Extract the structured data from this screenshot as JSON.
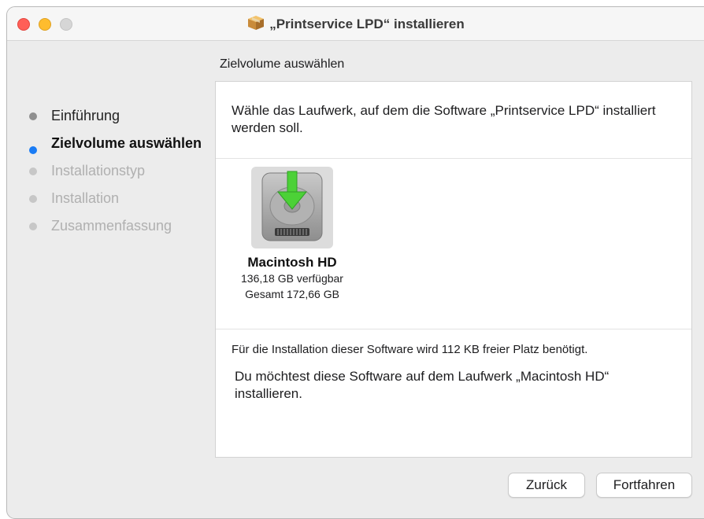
{
  "window": {
    "title": "„Printservice LPD“ installieren",
    "icon": "package-icon"
  },
  "section_heading": "Zielvolume auswählen",
  "steps": [
    {
      "label": "Einführung",
      "state": "done"
    },
    {
      "label": "Zielvolume auswählen",
      "state": "active"
    },
    {
      "label": "Installationstyp",
      "state": "pending"
    },
    {
      "label": "Installation",
      "state": "pending"
    },
    {
      "label": "Zusammenfassung",
      "state": "pending"
    }
  ],
  "panel": {
    "intro": "Wähle das Laufwerk, auf dem die Software „Printservice LPD“ installiert werden soll.",
    "volume": {
      "name": "Macintosh HD",
      "available": "136,18 GB verfügbar",
      "total": "Gesamt 172,66 GB",
      "icon": "hard-drive-install-icon"
    },
    "space_needed": "Für die Installation dieser Software wird 112 KB freier Platz benötigt.",
    "confirm": "Du möchtest diese Software auf dem Laufwerk „Macintosh HD“ installieren."
  },
  "buttons": {
    "back": "Zurück",
    "continue": "Fortfahren"
  },
  "colors": {
    "accent": "#1a7cf5",
    "close": "#ff5f57",
    "minimize": "#febc2e",
    "zoom_disabled": "#d6d6d6",
    "install_arrow": "#4cd137"
  }
}
